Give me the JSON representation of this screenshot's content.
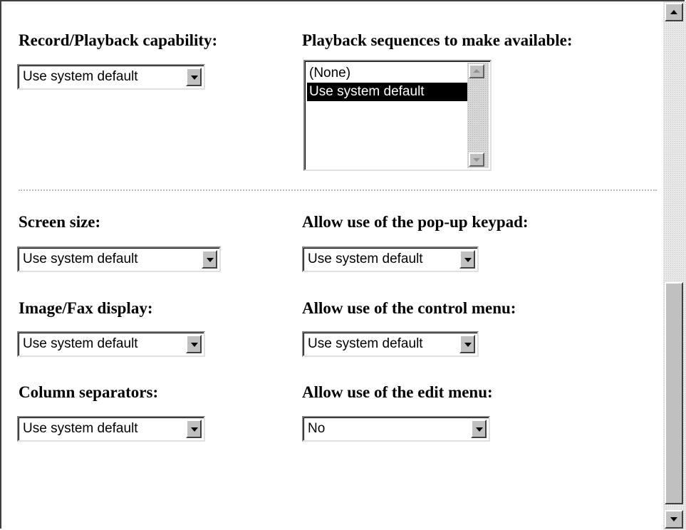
{
  "record_playback": {
    "label": "Record/Playback capability:",
    "value": "Use system default"
  },
  "playback_sequences": {
    "label": "Playback sequences to make available:",
    "options": [
      "(None)",
      "Use system default"
    ],
    "selected": "Use system default"
  },
  "screen_size": {
    "label": "Screen size:",
    "value": "Use system default"
  },
  "popup_keypad": {
    "label": "Allow use of the pop-up keypad:",
    "value": "Use system default"
  },
  "image_fax": {
    "label": "Image/Fax display:",
    "value": "Use system default"
  },
  "control_menu": {
    "label": "Allow use of the control menu:",
    "value": "Use system default"
  },
  "column_separators": {
    "label": "Column separators:",
    "value": "Use system default"
  },
  "edit_menu": {
    "label": "Allow use of the edit menu:",
    "value": "No"
  },
  "colors": {
    "selection_bg": "#000000",
    "selection_fg": "#ffffff",
    "button_face": "#c0c0c0"
  }
}
